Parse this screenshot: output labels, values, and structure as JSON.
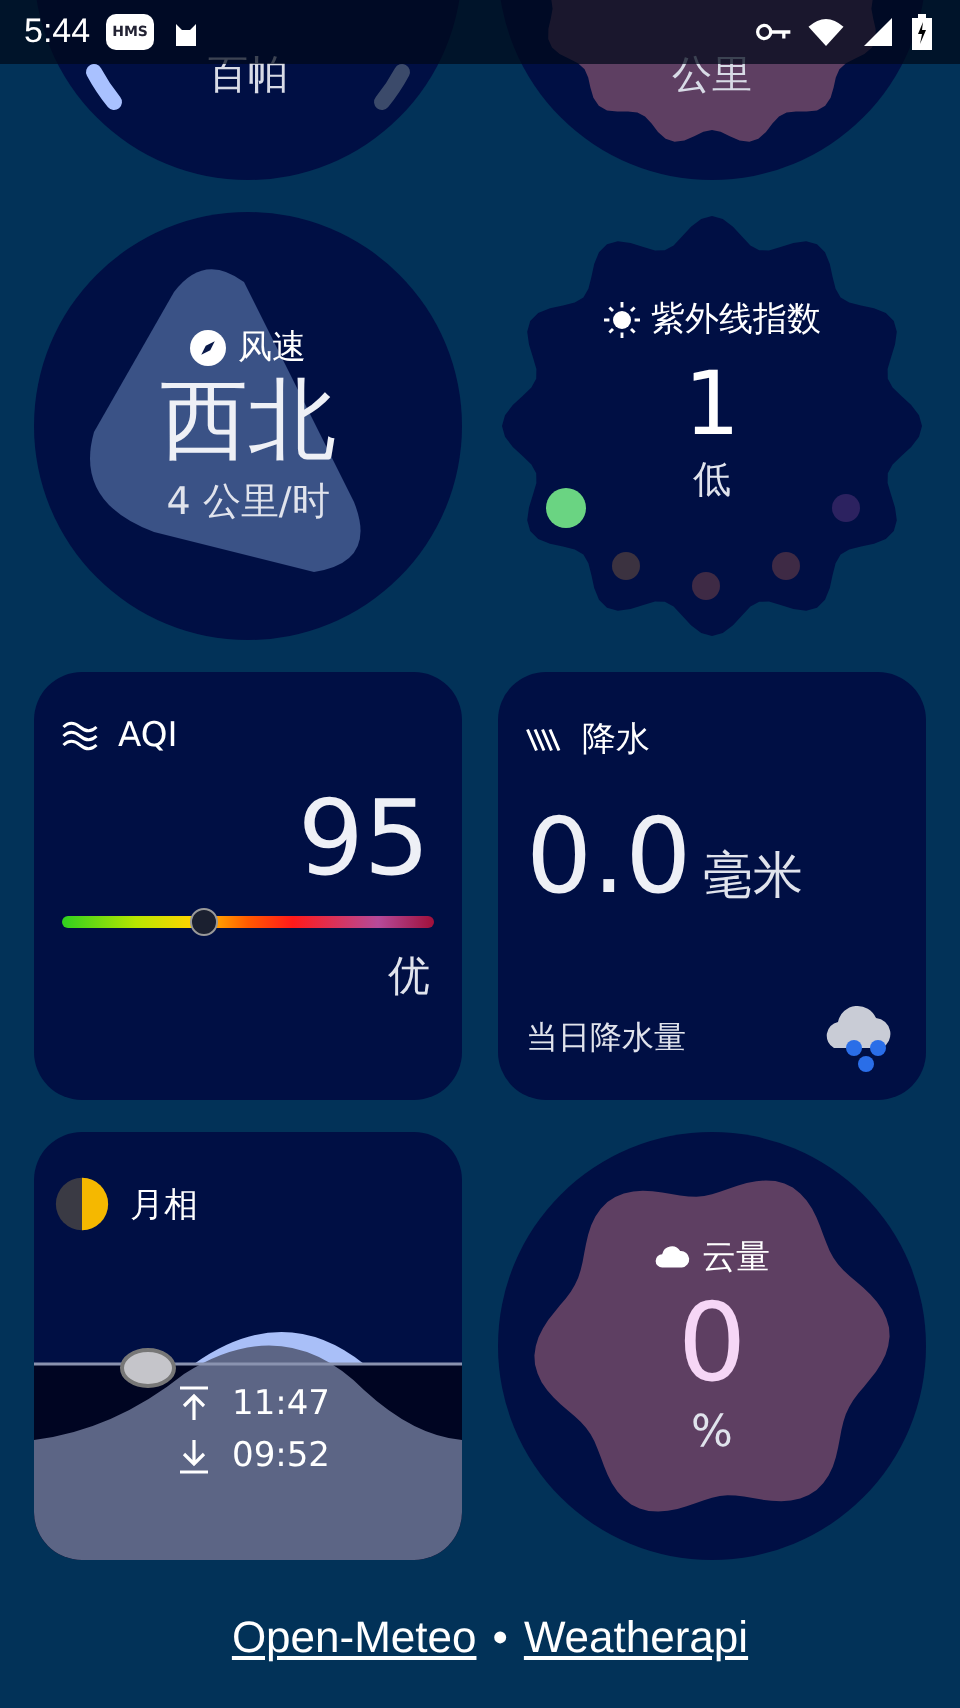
{
  "status_bar": {
    "time": "5:44",
    "badge": "HMS"
  },
  "top_cards": [
    {
      "kind": "gauge",
      "unit": "百帕"
    },
    {
      "kind": "blob",
      "unit": "公里"
    }
  ],
  "wind": {
    "title": "风速",
    "direction": "西北",
    "speed": "4 公里/时"
  },
  "uv": {
    "title": "紫外线指数",
    "value": "1",
    "label": "低",
    "dots": [
      {
        "color": "#6ad482"
      },
      {
        "color": "#3b3240"
      },
      {
        "color": "#3e2a45"
      },
      {
        "color": "#3e2a45"
      },
      {
        "color": "#2c2260"
      }
    ]
  },
  "aqi": {
    "title": "AQI",
    "value": "95",
    "level": 0.38,
    "label": "优"
  },
  "precipitation": {
    "title": "降水",
    "value": "0.0",
    "unit": "毫米",
    "caption": "当日降水量"
  },
  "moon": {
    "title": "月相",
    "rise": "11:47",
    "set": "09:52"
  },
  "cloud": {
    "title": "云量",
    "value": "0",
    "unit": "%"
  },
  "footer": {
    "links": [
      "Open-Meteo",
      "Weatherapi"
    ],
    "separator": "•"
  }
}
